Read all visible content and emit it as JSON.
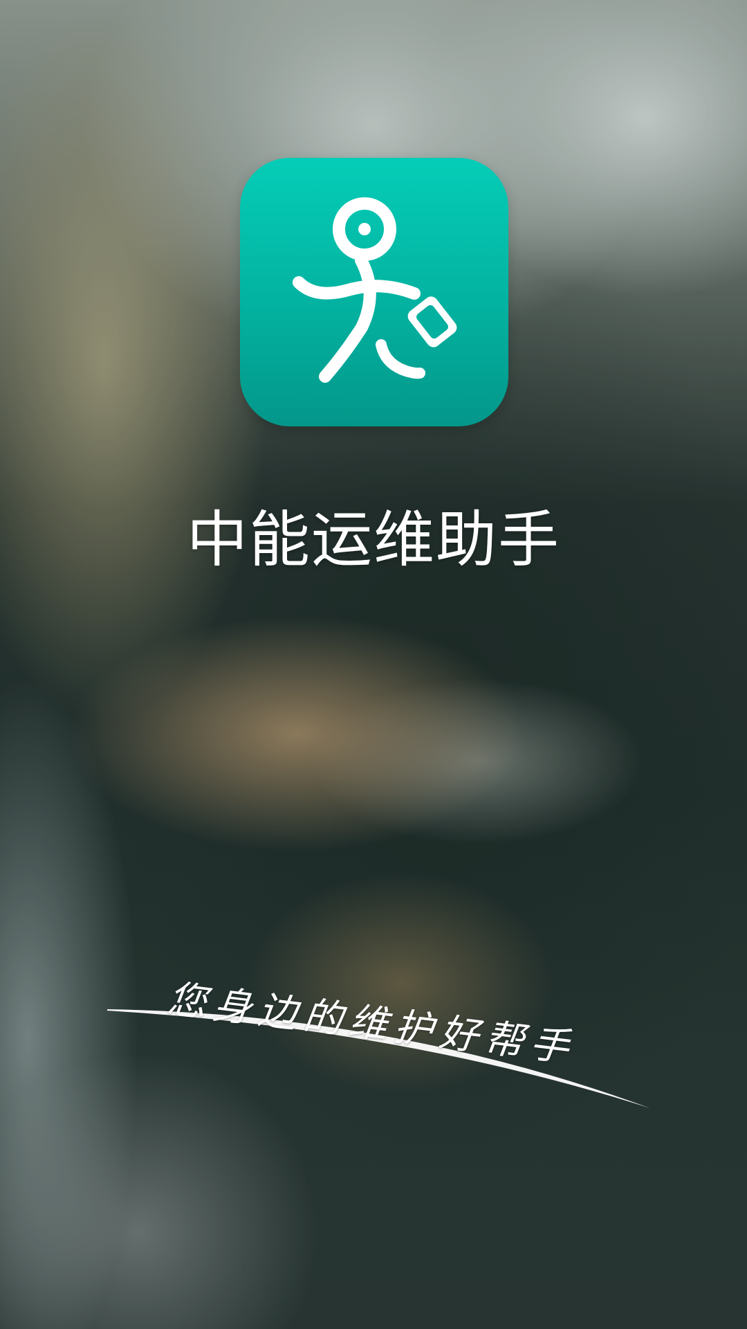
{
  "app": {
    "name": "中能运维助手",
    "slogan": "您身边的维护好帮手",
    "icon": "walking-person-with-briefcase-icon"
  },
  "colors": {
    "icon_top": "#05cdb7",
    "icon_bottom": "#03978a",
    "text": "#ffffff"
  }
}
